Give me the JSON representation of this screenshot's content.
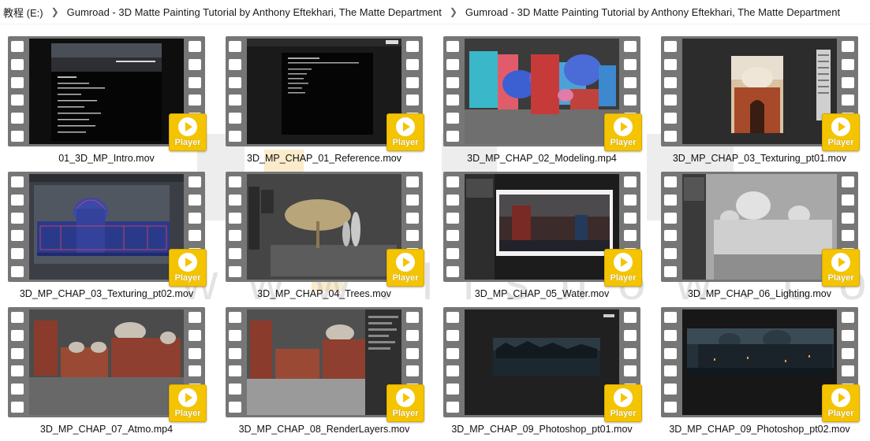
{
  "breadcrumb": [
    "教程 (E:)",
    "Gumroad - 3D Matte Painting Tutorial by Anthony Eftekhari, The Matte Department",
    "Gumroad - 3D Matte Painting Tutorial by Anthony Eftekhari, The Matte Department"
  ],
  "badge_label": "Player",
  "files": [
    {
      "name": "01_3D_MP_Intro.mov",
      "thumb": "intro-slide"
    },
    {
      "name": "3D_MP_CHAP_01_Reference.mov",
      "thumb": "reference-slide"
    },
    {
      "name": "3D_MP_CHAP_02_Modeling.mp4",
      "thumb": "colored-blocks"
    },
    {
      "name": "3D_MP_CHAP_03_Texturing_pt01.mov",
      "thumb": "temple-photo"
    },
    {
      "name": "3D_MP_CHAP_03_Texturing_pt02.mov",
      "thumb": "blue-wireframe"
    },
    {
      "name": "3D_MP_CHAP_04_Trees.mov",
      "thumb": "tree-viewport"
    },
    {
      "name": "3D_MP_CHAP_05_Water.mov",
      "thumb": "water-render"
    },
    {
      "name": "3D_MP_CHAP_06_Lighting.mov",
      "thumb": "grey-palace"
    },
    {
      "name": "3D_MP_CHAP_07_Atmo.mp4",
      "thumb": "textured-palace"
    },
    {
      "name": "3D_MP_CHAP_08_RenderLayers.mov",
      "thumb": "render-layers"
    },
    {
      "name": "3D_MP_CHAP_09_Photoshop_pt01.mov",
      "thumb": "dark-city"
    },
    {
      "name": "3D_MP_CHAP_09_Photoshop_pt02.mov",
      "thumb": "dusk-city"
    }
  ],
  "watermark": {
    "text": "www.llshow.com",
    "glyph_color": "#cfcfcf"
  }
}
